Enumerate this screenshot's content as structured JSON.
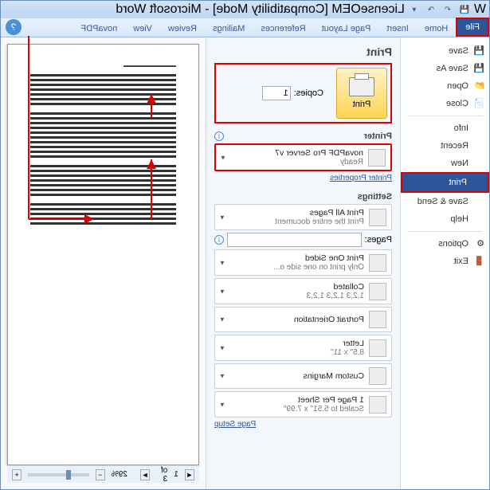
{
  "window": {
    "app_icon": "W",
    "title": "LicenseOEM [Compatibility Mode] - Microsoft Word"
  },
  "ribbon": {
    "tabs": [
      "File",
      "Home",
      "Insert",
      "Page Layout",
      "References",
      "Mailings",
      "Review",
      "View",
      "novaPDF"
    ]
  },
  "nav": {
    "items": [
      "Save",
      "Save As",
      "Open",
      "Close",
      "Info",
      "Recent",
      "New",
      "Print",
      "Save & Send",
      "Help",
      "Options",
      "Exit"
    ],
    "selected": "Print"
  },
  "print": {
    "heading": "Print",
    "button": "Print",
    "copies_label": "Copies:",
    "copies_value": "1",
    "printer_heading": "Printer",
    "printer_name": "novaPDF Pro Server v7",
    "printer_status": "Ready",
    "printer_props": "Printer Properties",
    "settings_heading": "Settings",
    "range_title": "Print All Pages",
    "range_sub": "Print the entire document",
    "pages_label": "Pages:",
    "sided_title": "Print One Sided",
    "sided_sub": "Only print on one side o...",
    "collate_title": "Collated",
    "collate_sub": "1,2,3   1,2,3   1,2,3",
    "orient_title": "Portrait Orientation",
    "paper_title": "Letter",
    "paper_sub": "8.5\" x 11\"",
    "margins_title": "Custom Margins",
    "sheet_title": "1 Page Per Sheet",
    "sheet_sub": "Scaled to 5.51\" x 7.99\"",
    "page_setup": "Page Setup"
  },
  "status": {
    "page_of": "of 3",
    "page_num": "1",
    "zoom": "29%"
  }
}
